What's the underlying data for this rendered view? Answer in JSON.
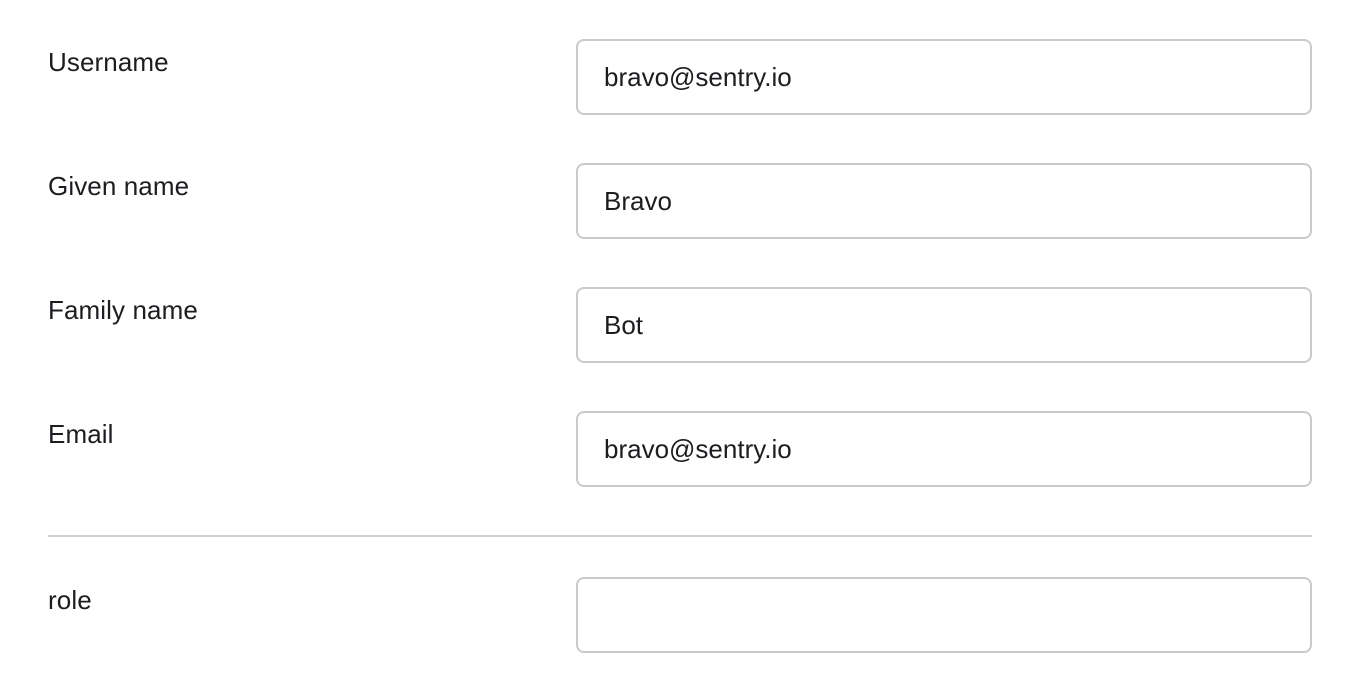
{
  "form": {
    "fields": [
      {
        "label": "Username",
        "value": "bravo@sentry.io"
      },
      {
        "label": "Given name",
        "value": "Bravo"
      },
      {
        "label": "Family name",
        "value": "Bot"
      },
      {
        "label": "Email",
        "value": "bravo@sentry.io"
      },
      {
        "label": "role",
        "value": ""
      }
    ]
  },
  "colors": {
    "text": "#1d1d21",
    "border": "#c9c9ce",
    "divider": "#cfcfd3",
    "background": "#ffffff"
  }
}
